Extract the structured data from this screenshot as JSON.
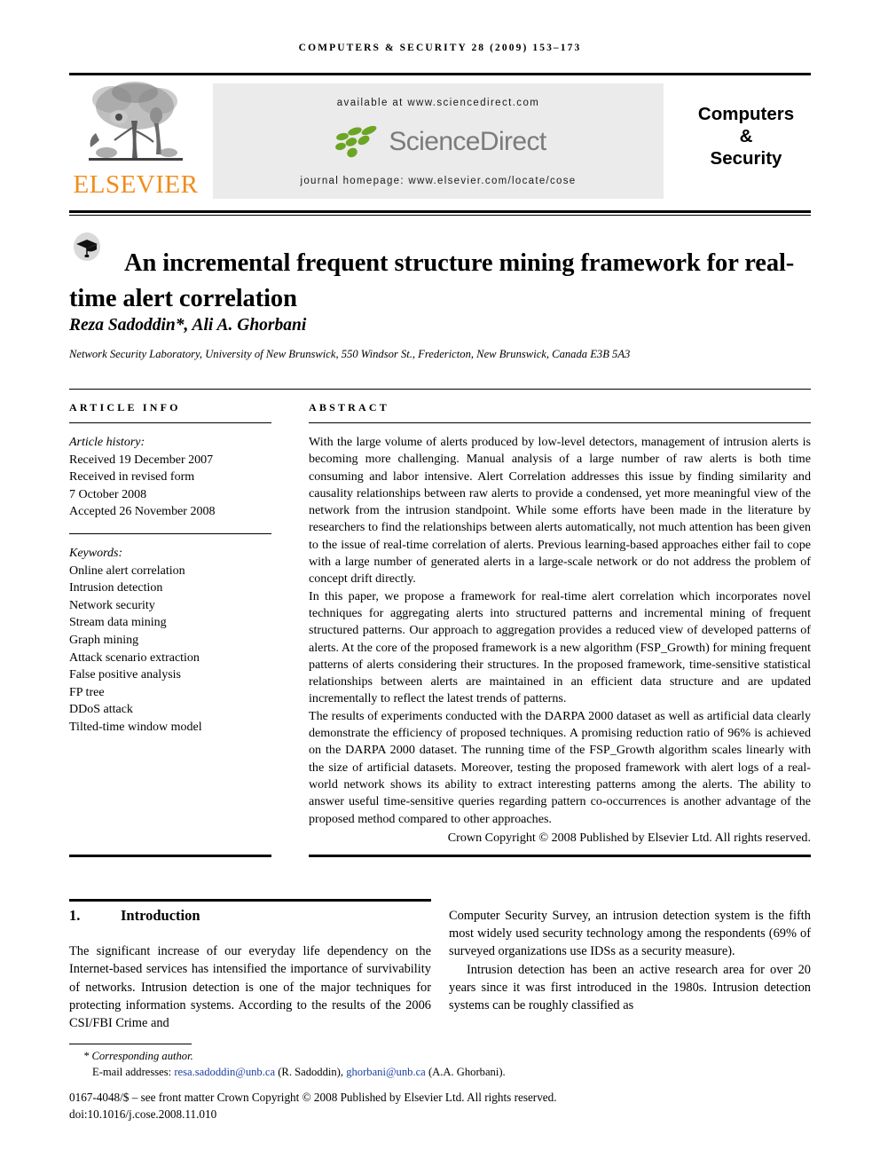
{
  "running_head": "Computers & Security 28 (2009) 153–173",
  "masthead": {
    "publisher_name": "ELSEVIER",
    "available_at": "available at www.sciencedirect.com",
    "sciencedirect_wordmark": "ScienceDirect",
    "journal_homepage": "journal homepage: www.elsevier.com/locate/cose",
    "journal_title_line1": "Computers",
    "journal_title_line2": "&",
    "journal_title_line3": "Security"
  },
  "article": {
    "title_line1": "An incremental frequent structure mining framework",
    "title_line2": "for real-time alert correlation",
    "authors": "Reza Sadoddin*, Ali A. Ghorbani",
    "affiliation": "Network Security Laboratory, University of New Brunswick, 550 Windsor St., Fredericton, New Brunswick, Canada E3B 5A3"
  },
  "article_info": {
    "heading": "ARTICLE INFO",
    "history_label": "Article history:",
    "history": [
      "Received 19 December 2007",
      "Received in revised form",
      "7 October 2008",
      "Accepted 26 November 2008"
    ],
    "keywords_label": "Keywords:",
    "keywords": [
      "Online alert correlation",
      "Intrusion detection",
      "Network security",
      "Stream data mining",
      "Graph mining",
      "Attack scenario extraction",
      "False positive analysis",
      "FP tree",
      "DDoS attack",
      "Tilted-time window model"
    ]
  },
  "abstract": {
    "heading": "ABSTRACT",
    "paragraphs": [
      "With the large volume of alerts produced by low-level detectors, management of intrusion alerts is becoming more challenging. Manual analysis of a large number of raw alerts is both time consuming and labor intensive. Alert Correlation addresses this issue by finding similarity and causality relationships between raw alerts to provide a condensed, yet more meaningful view of the network from the intrusion standpoint. While some efforts have been made in the literature by researchers to find the relationships between alerts automatically, not much attention has been given to the issue of real-time correlation of alerts. Previous learning-based approaches either fail to cope with a large number of generated alerts in a large-scale network or do not address the problem of concept drift directly.",
      "In this paper, we propose a framework for real-time alert correlation which incorporates novel techniques for aggregating alerts into structured patterns and incremental mining of frequent structured patterns. Our approach to aggregation provides a reduced view of developed patterns of alerts. At the core of the proposed framework is a new algorithm (FSP_Growth) for mining frequent patterns of alerts considering their structures. In the proposed framework, time-sensitive statistical relationships between alerts are maintained in an efficient data structure and are updated incrementally to reflect the latest trends of patterns.",
      "The results of experiments conducted with the DARPA 2000 dataset as well as artificial data clearly demonstrate the efficiency of proposed techniques. A promising reduction ratio of 96% is achieved on the DARPA 2000 dataset. The running time of the FSP_Growth algorithm scales linearly with the size of artificial datasets. Moreover, testing the proposed framework with alert logs of a real-world network shows its ability to extract interesting patterns among the alerts. The ability to answer useful time-sensitive queries regarding pattern co-occurrences is another advantage of the proposed method compared to other approaches."
    ],
    "copyright": "Crown Copyright © 2008 Published by Elsevier Ltd. All rights reserved."
  },
  "body": {
    "section_number": "1.",
    "section_title": "Introduction",
    "left_column": "The significant increase of our everyday life dependency on the Internet-based services has intensified the importance of survivability of networks. Intrusion detection is one of the major techniques for protecting information systems. According to the results of the 2006 CSI/FBI Crime and",
    "right_column_p1": "Computer Security Survey, an intrusion detection system is the fifth most widely used security technology among the respondents (69% of surveyed organizations use IDSs as a security measure).",
    "right_column_p2": "Intrusion detection has been an active research area for over 20 years since it was first introduced in the 1980s. Intrusion detection systems can be roughly classified as"
  },
  "footer": {
    "corresponding_author": "* Corresponding author.",
    "email_label": "E-mail addresses:",
    "email1": "resa.sadoddin@unb.ca",
    "email1_name": "(R. Sadoddin),",
    "email2": "ghorbani@unb.ca",
    "email2_name": "(A.A. Ghorbani).",
    "issn_line": "0167-4048/$ – see front matter Crown Copyright © 2008 Published by Elsevier Ltd. All rights reserved.",
    "doi_line": "doi:10.1016/j.cose.2008.11.010"
  },
  "colors": {
    "elsevier_orange": "#F08C1C",
    "sciencedirect_green": "#6CA524",
    "sciencedirect_gray": "#7b7b7b",
    "link_blue": "#1a3fa0",
    "panel_gray": "#ebebeb"
  }
}
